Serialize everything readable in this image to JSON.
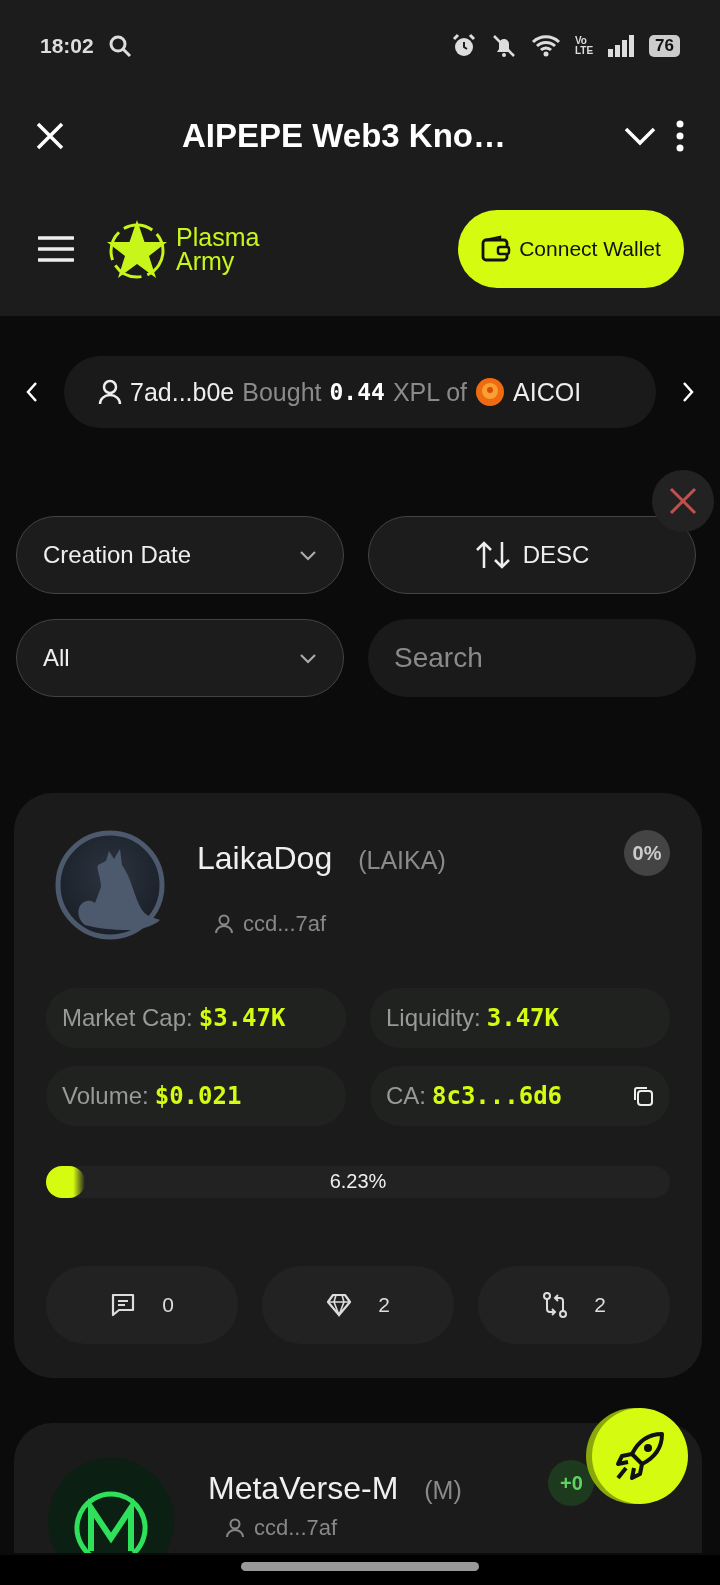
{
  "status_bar": {
    "time": "18:02",
    "network": [
      "Vo",
      "LTE"
    ],
    "battery": "76"
  },
  "title_bar": {
    "title": "AIPEPE Web3 Kno…"
  },
  "header": {
    "logo": [
      "Plasma",
      "Army"
    ],
    "connect_button": "Connect Wallet"
  },
  "ticker": {
    "user": "7ad...b0e",
    "action": "Bought",
    "amount": "0.44",
    "unit": "XPL of",
    "token": "AICOI"
  },
  "filters": {
    "sort_by": "Creation Date",
    "order": "DESC",
    "category": "All",
    "search": {
      "placeholder": "Search"
    }
  },
  "tokens": [
    {
      "kind": "dog",
      "name": "LaikaDog",
      "symbol": "(LAIKA)",
      "creator": "ccd...7af",
      "change": "0%",
      "color": "#444444",
      "stats": [
        {
          "label": "Market Cap:",
          "value": "$3.47K",
          "copy": false
        },
        {
          "label": "Liquidity:",
          "value": "3.47K",
          "copy": false
        },
        {
          "label": "Volume:",
          "value": "$0.021",
          "copy": false
        },
        {
          "label": "CA:",
          "value": "8c3...6d6",
          "copy": true
        }
      ],
      "progress": {
        "level": 0.0623,
        "reading": "6.23%"
      },
      "counts": [
        {
          "kind": "comments",
          "value": "0"
        },
        {
          "kind": "gems",
          "value": "2"
        },
        {
          "kind": "trades",
          "value": "2"
        }
      ]
    },
    {
      "kind": "m",
      "name": "MetaVerse-M",
      "symbol": "(M)",
      "creator": "ccd...7af",
      "change": "+0",
      "color": "#1e3a1e"
    }
  ]
}
